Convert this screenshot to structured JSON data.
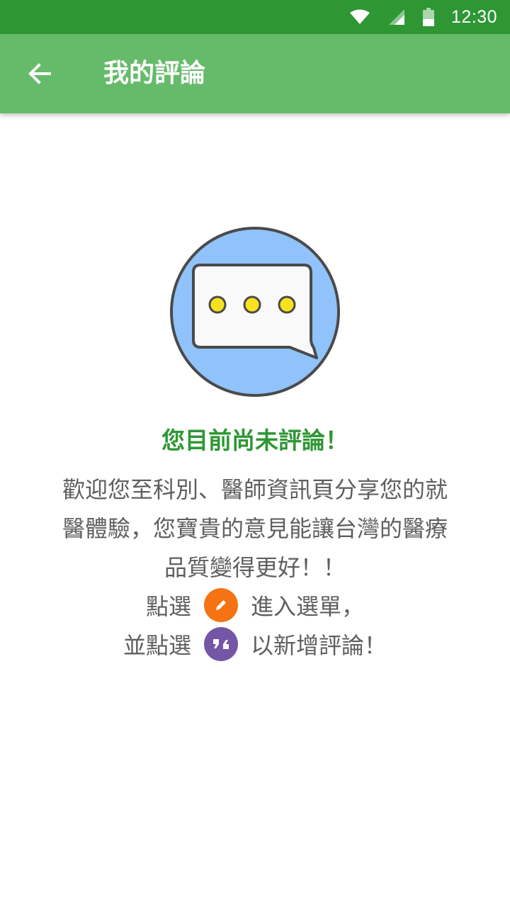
{
  "status_bar": {
    "time": "12:30",
    "icons": [
      "wifi-icon",
      "cell-signal-icon",
      "battery-icon"
    ]
  },
  "app_bar": {
    "back_icon": "arrow-left-icon",
    "title": "我的評論"
  },
  "empty_state": {
    "illustration_icon": "chat-bubble-icon",
    "title": "您目前尚未評論！",
    "description_lines": [
      "歡迎您至科別、醫師資訊頁分享您的就",
      "醫體驗，您寶貴的意見能讓台灣的醫療",
      "品質變得更好！！"
    ],
    "hint_1": {
      "prefix": "點選",
      "icon": "pencil-icon",
      "suffix": "進入選單，"
    },
    "hint_2": {
      "prefix": "並點選",
      "icon": "quote-icon",
      "suffix": "以新增評論！"
    }
  },
  "colors": {
    "status_bar": "#2e9734",
    "app_bar": "#66bb6a",
    "title_green": "#2e9734",
    "body_text": "#5f5f5f",
    "illustration_bg": "#90c2fb",
    "dots": "#f7e21f",
    "pencil_button": "#f57312",
    "quote_button": "#7455a6"
  }
}
